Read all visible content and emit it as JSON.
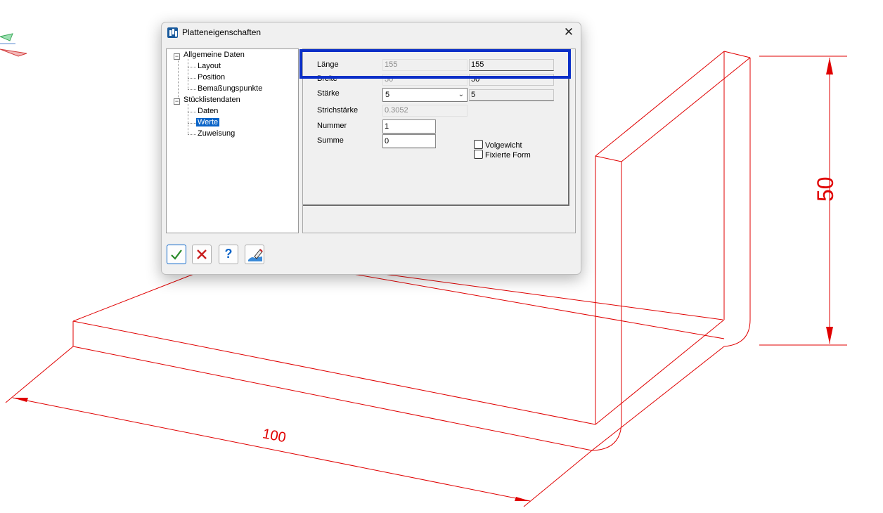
{
  "dialog": {
    "title": "Platteneigenschaften",
    "close_glyph": "✕"
  },
  "tree": {
    "items": [
      {
        "label": "Allgemeine Daten",
        "toggle": "−"
      },
      {
        "label": "Layout"
      },
      {
        "label": "Position"
      },
      {
        "label": "Bemaßungspunkte"
      },
      {
        "label": "Stücklistendaten",
        "toggle": "−"
      },
      {
        "label": "Daten"
      },
      {
        "label": "Werte",
        "selected": true
      },
      {
        "label": "Zuweisung"
      }
    ]
  },
  "form": {
    "laenge": {
      "label": "Länge",
      "computed": "155",
      "value": "155"
    },
    "breite": {
      "label": "Breite",
      "computed": "50",
      "value": "50"
    },
    "staerke": {
      "label": "Stärke",
      "selected": "5",
      "value": "5"
    },
    "strichstaerke": {
      "label": "Strichstärke",
      "value": "0.3052"
    },
    "nummer": {
      "label": "Nummer",
      "value": "1"
    },
    "summe": {
      "label": "Summe",
      "value": "0"
    },
    "volgewicht": {
      "label": "Volgewicht",
      "checked": false
    },
    "fixierte_form": {
      "label": "Fixierte Form",
      "checked": false
    }
  },
  "buttons": {
    "ok_icon": "checkmark-icon",
    "cancel_icon": "cross-icon",
    "help_glyph": "?",
    "edit_icon": "pencil-edit-icon"
  },
  "drawing": {
    "dimension_width": "100",
    "dimension_height": "50",
    "line_color": "#e00000",
    "highlight_color": "#0a2fc8"
  }
}
